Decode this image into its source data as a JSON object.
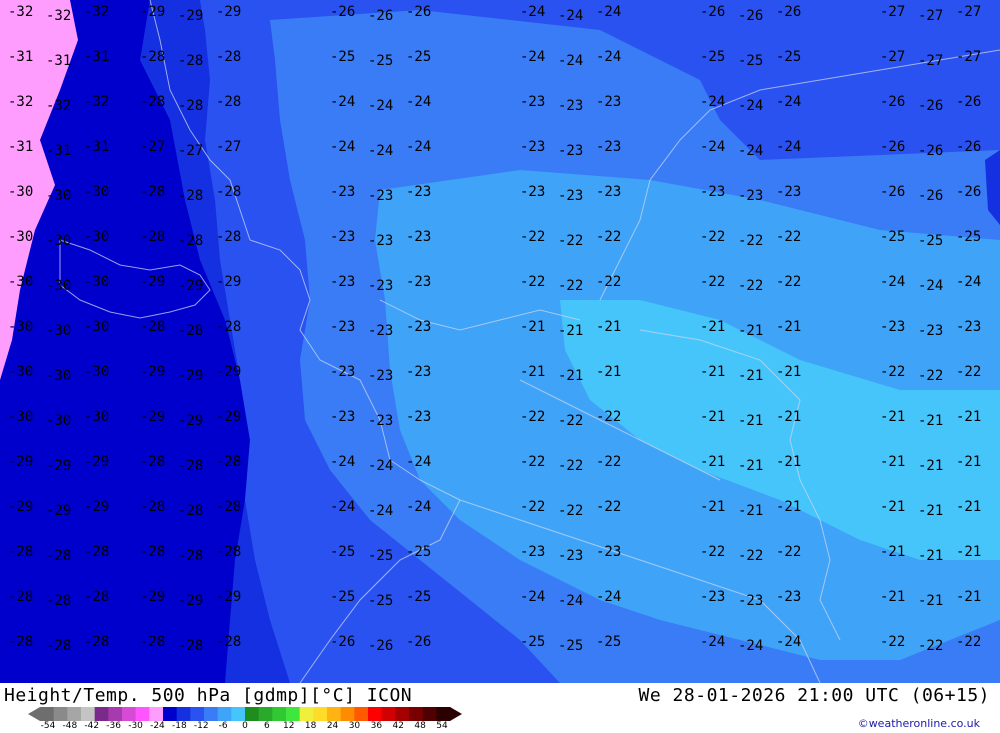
{
  "map": {
    "field_values": {
      "col_far_west": [
        "32",
        "31",
        "32",
        "31",
        "30",
        "30",
        "30",
        "30",
        "30",
        "30",
        "29",
        "29",
        "28",
        "28",
        "28"
      ],
      "col_west": [
        "29",
        "28",
        "28",
        "27",
        "28",
        "28",
        "29",
        "28",
        "29",
        "29",
        "28",
        "28",
        "28",
        "29",
        "28"
      ],
      "col_center_west": [
        "26",
        "25",
        "24",
        "24",
        "23",
        "23",
        "23",
        "23",
        "23",
        "23",
        "24",
        "24",
        "25",
        "25",
        "26"
      ],
      "col_center": [
        "24",
        "24",
        "23",
        "23",
        "23",
        "22",
        "22",
        "21",
        "21",
        "22",
        "22",
        "22",
        "23",
        "24",
        "25"
      ],
      "col_center_east": [
        "26",
        "25",
        "24",
        "24",
        "23",
        "22",
        "22",
        "21",
        "21",
        "21",
        "21",
        "21",
        "22",
        "23",
        "24"
      ],
      "col_east": [
        "27",
        "27",
        "26",
        "26",
        "26",
        "25",
        "24",
        "23",
        "22",
        "21",
        "21",
        "21",
        "21",
        "21",
        "22"
      ]
    },
    "colors": {
      "band_minus32": "#ff9dff",
      "band_minus30": "#0000cc",
      "band_minus28": "#1430e0",
      "band_minus26": "#2a52f0",
      "band_minus24": "#3a7cf5",
      "band_minus22": "#3fa3f8",
      "band_minus20": "#46c5fb",
      "contour_label": "#000000"
    }
  },
  "footer": {
    "title": "Height/Temp. 500 hPa [gdmp][°C] ICON",
    "valid_time": "We 28-01-2026 21:00 UTC (06+15)",
    "credit": "©weatheronline.co.uk",
    "scale_ticks": [
      "-54",
      "-48",
      "-42",
      "-36",
      "-30",
      "-24",
      "-18",
      "-12",
      "-6",
      "0",
      "6",
      "12",
      "18",
      "24",
      "30",
      "36",
      "42",
      "48",
      "54"
    ],
    "scale_colors": [
      "#6e6e6e",
      "#8a8a8a",
      "#a6a6a6",
      "#c4c4c4",
      "#7a2a8a",
      "#a63aae",
      "#d64ad6",
      "#ff55ff",
      "#ff9dff",
      "#0000cc",
      "#1430e0",
      "#2a52f0",
      "#3a7cf5",
      "#3fa3f8",
      "#46c5fb",
      "#1e8c1e",
      "#2aaa2a",
      "#32c832",
      "#3ee63e",
      "#f0f03c",
      "#ffdc28",
      "#ffb414",
      "#ff8c00",
      "#ff5a00",
      "#ff0000",
      "#d20000",
      "#a50000",
      "#780000",
      "#500000",
      "#2a0000"
    ]
  }
}
